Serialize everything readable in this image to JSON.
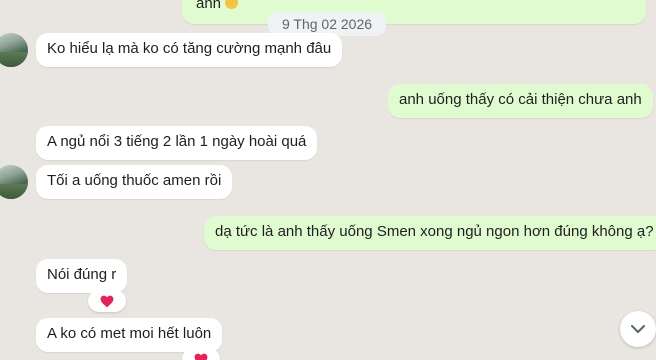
{
  "date_separator": "9 Thg 02 2026",
  "messages": [
    {
      "text": "anh",
      "emoji": "smile"
    },
    {
      "text": "Ko hiểu lạ  mà ko có tăng cường   mạnh đâu"
    },
    {
      "text": "anh uống thấy có cải thiện chưa anh"
    },
    {
      "text": "A ngủ nổi 3 tiếng  2 lần 1 ngày hoài quá"
    },
    {
      "text": "Tối a uống thuốc amen rồi"
    },
    {
      "text": "dạ tức là anh thấy uống Smen xong ngủ ngon hơn đúng không ạ?"
    },
    {
      "text": "Nói đúng r",
      "reaction": "heart"
    },
    {
      "text": "A ko có met moi hết luôn",
      "reaction": "heart"
    }
  ],
  "colors": {
    "background": "#e9e6e2",
    "incoming_bubble": "#ffffff",
    "outgoing_bubble": "#e1fbd1",
    "heart": "#e3245b"
  },
  "icons": {
    "scroll_down": "chevron-down-icon",
    "reaction": "heart-icon"
  }
}
